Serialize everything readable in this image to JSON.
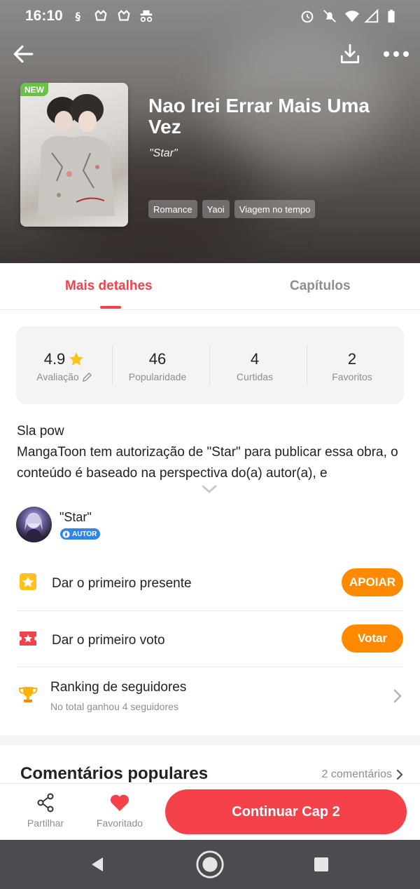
{
  "status_bar": {
    "time": "16:10",
    "left_icons": [
      "sim-icon",
      "game-icon",
      "game-icon",
      "incognito-icon"
    ],
    "right_icons": [
      "alarm-icon",
      "bell-off-icon",
      "wifi-icon",
      "signal-icon",
      "battery-icon"
    ]
  },
  "header": {
    "new_badge": "NEW",
    "title": "Nao Irei Errar Mais Uma Vez",
    "author": "\"Star\"",
    "tags": [
      "Romance",
      "Yaoi",
      "Viagem no tempo"
    ]
  },
  "tabs": {
    "details": "Mais detalhes",
    "chapters": "Capítulos"
  },
  "stats": [
    {
      "value": "4.9",
      "label": "Avaliação"
    },
    {
      "value": "46",
      "label": "Popularidade"
    },
    {
      "value": "4",
      "label": "Curtidas"
    },
    {
      "value": "2",
      "label": "Favoritos"
    }
  ],
  "description": {
    "line1": "Sla pow",
    "line2": "MangaToon tem autorização de \"Star\" para publicar essa obra, o conteúdo é baseado na perspectiva do(a) autor(a), e"
  },
  "author": {
    "name": "\"Star\"",
    "badge": "AUTOR"
  },
  "gift_row": {
    "text": "Dar o primeiro presente",
    "button": "APOIAR"
  },
  "vote_row": {
    "text": "Dar o primeiro voto",
    "button": "Votar"
  },
  "ranking": {
    "title": "Ranking de seguidores",
    "subtitle": "No total ganhou 4 seguidores"
  },
  "comments": {
    "title": "Comentários populares",
    "count": "2 comentários"
  },
  "bottom_bar": {
    "share": "Partilhar",
    "favorite": "Favoritado",
    "continue": "Continuar Cap 2"
  },
  "colors": {
    "accent": "#f5414a",
    "orange": "#ff8a00",
    "new_badge": "#6cc04a",
    "author_badge": "#2f86e8"
  }
}
